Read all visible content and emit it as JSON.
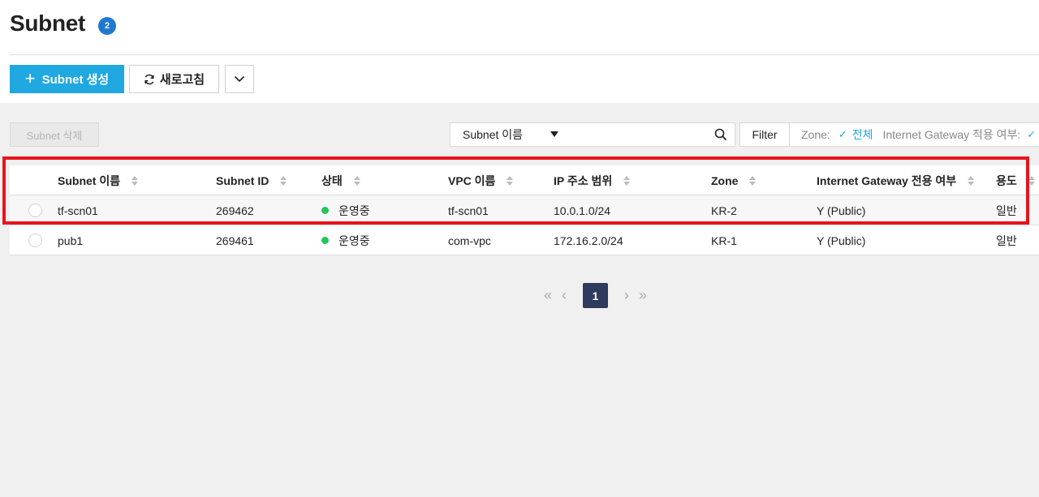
{
  "header": {
    "title": "Subnet",
    "count": "2"
  },
  "toolbar": {
    "create_label": "Subnet 생성",
    "refresh_label": "새로고침"
  },
  "actions": {
    "delete_label": "Subnet 삭제"
  },
  "search": {
    "field": "Subnet 이름",
    "value": ""
  },
  "filter": {
    "button_label": "Filter",
    "zone_label": "Zone:",
    "zone_value": "전체",
    "igw_label": "Internet Gateway 적용 여부:"
  },
  "table": {
    "columns": [
      "Subnet 이름",
      "Subnet ID",
      "상태",
      "VPC 이름",
      "IP 주소 범위",
      "Zone",
      "Internet Gateway 전용 여부",
      "용도"
    ],
    "rows": [
      {
        "name": "tf-scn01",
        "id": "269462",
        "status": "운영중",
        "vpc": "tf-scn01",
        "ip": "10.0.1.0/24",
        "zone": "KR-2",
        "igw": "Y (Public)",
        "usage": "일반"
      },
      {
        "name": "pub1",
        "id": "269461",
        "status": "운영중",
        "vpc": "com-vpc",
        "ip": "172.16.2.0/24",
        "zone": "KR-1",
        "igw": "Y (Public)",
        "usage": "일반"
      }
    ]
  },
  "pagination": {
    "current": "1"
  },
  "colors": {
    "accent": "#20a8e0",
    "badge": "#1f78d1",
    "status_ok": "#22c65b",
    "highlight": "#e8141c",
    "page_current": "#2e3b5e"
  }
}
